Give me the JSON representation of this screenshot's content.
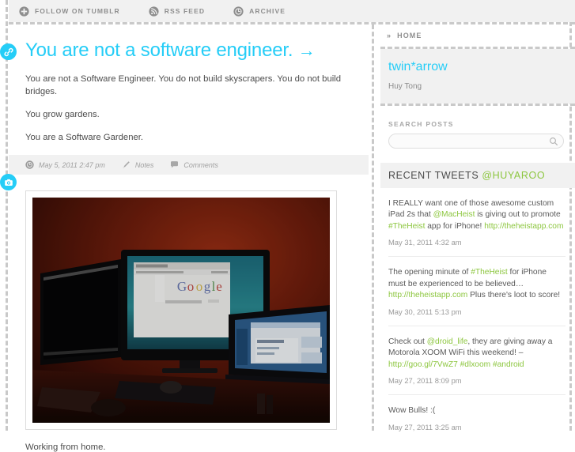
{
  "topbar": {
    "items": [
      {
        "label": "FOLLOW ON TUMBLR",
        "icon": "plus-circle-icon"
      },
      {
        "label": "RSS FEED",
        "icon": "rss-icon"
      },
      {
        "label": "ARCHIVE",
        "icon": "archive-clock-icon"
      }
    ]
  },
  "post": {
    "title": "You are not a software engineer.",
    "title_arrow": "→",
    "paragraphs": [
      "You are not a Software Engineer. You do not build skyscrapers. You do not build bridges.",
      "You grow gardens.",
      "You are a Software Gardener."
    ],
    "meta": {
      "date": "May 5, 2011 2:47 pm",
      "notes_label": "Notes",
      "comments_label": "Comments"
    },
    "photo_caption": "Working from home.",
    "photo_alt": "Dark home office with three monitors, Google page open, laptop on the right"
  },
  "sidebar": {
    "home_label": "HOME",
    "home_chevron": "»",
    "blog_title": "twin*arrow",
    "author": "Huy Tong",
    "search": {
      "label": "SEARCH POSTS",
      "value": "",
      "placeholder": ""
    },
    "tweets": {
      "heading": "RECENT TWEETS",
      "handle": "@HUYAROO",
      "items": [
        {
          "time": "May 31, 2011 4:32 am",
          "parts": [
            {
              "t": "I REALLY want one of those awesome custom iPad 2s that ",
              "link": false
            },
            {
              "t": "@MacHeist",
              "link": true
            },
            {
              "t": " is giving out to promote ",
              "link": false
            },
            {
              "t": "#TheHeist",
              "link": true
            },
            {
              "t": " app for iPhone! ",
              "link": false
            },
            {
              "t": "http://theheistapp.com",
              "link": true
            }
          ]
        },
        {
          "time": "May 30, 2011 5:13 pm",
          "parts": [
            {
              "t": "The opening minute of ",
              "link": false
            },
            {
              "t": "#TheHeist",
              "link": true
            },
            {
              "t": " for iPhone must be experienced to be believed… ",
              "link": false
            },
            {
              "t": "http://theheistapp.com",
              "link": true
            },
            {
              "t": " Plus there's loot to score!",
              "link": false
            }
          ]
        },
        {
          "time": "May 27, 2011 8:09 pm",
          "parts": [
            {
              "t": "Check out ",
              "link": false
            },
            {
              "t": "@droid_life",
              "link": true
            },
            {
              "t": ", they are giving away a Motorola XOOM WiFi this weekend! – ",
              "link": false
            },
            {
              "t": "http://goo.gl/7VwZ7 #dlxoom #android",
              "link": true
            }
          ]
        },
        {
          "time": "May 27, 2011 3:25 am",
          "parts": [
            {
              "t": "Wow Bulls! :(",
              "link": false
            }
          ]
        }
      ]
    }
  },
  "colors": {
    "accent_cyan": "#25cdf7",
    "accent_green": "#8cc63e",
    "panel_gray": "#f1f1f1",
    "dash_gray": "#c9c9c9"
  }
}
